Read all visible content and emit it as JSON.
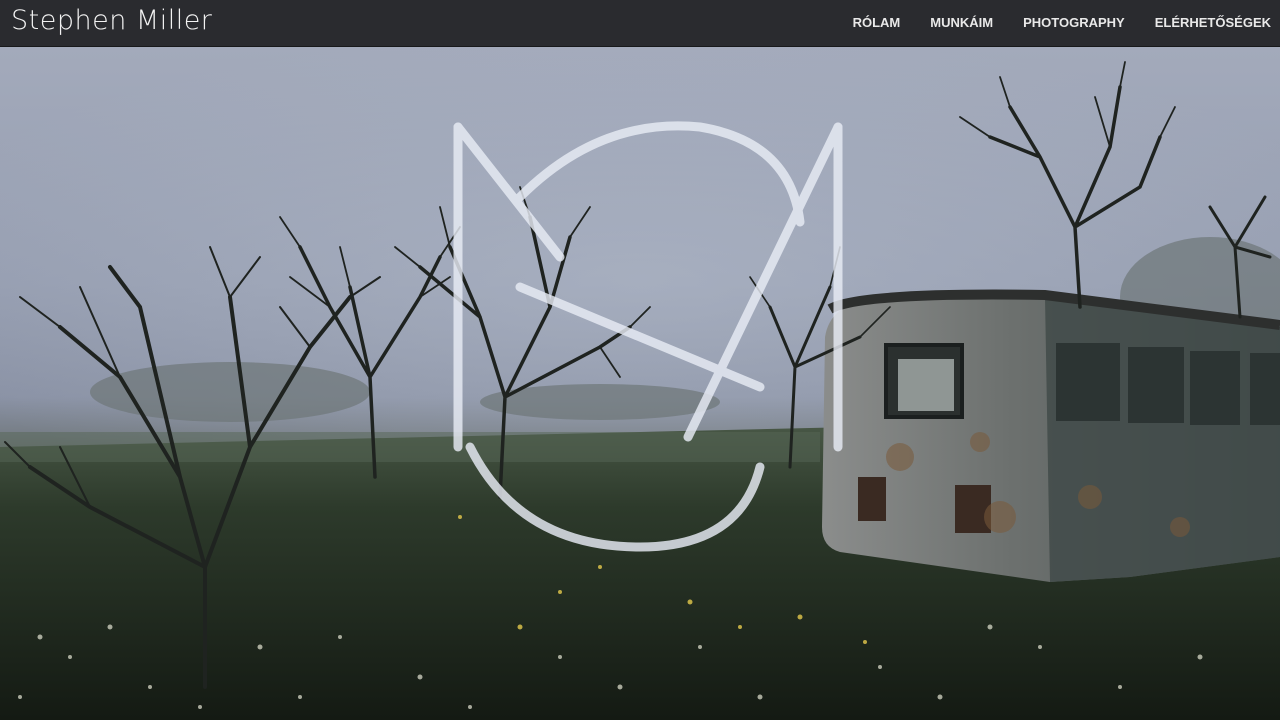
{
  "site": {
    "brand": "Stephen Miller"
  },
  "nav": {
    "items": [
      {
        "label": "RÓLAM",
        "name": "nav-item-rolam"
      },
      {
        "label": "MUNKÁIM",
        "name": "nav-item-munkaim"
      },
      {
        "label": "PHOTOGRAPHY",
        "name": "nav-item-photography"
      },
      {
        "label": "ELÉRHETŐSÉGEK",
        "name": "nav-item-elerhetosegek"
      }
    ]
  },
  "colors": {
    "topbar_bg": "#2a2b2f",
    "nav_text": "#e9e9e9",
    "logo_stroke": "#e8ecf5"
  },
  "hero": {
    "image": "foggy-field-abandoned-trailer-photo",
    "logo_mark": "sm-monogram-logo"
  }
}
